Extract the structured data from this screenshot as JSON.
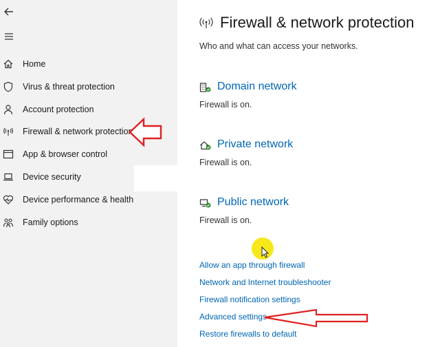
{
  "sidebar": {
    "back_icon": "back-arrow-icon",
    "menu_icon": "hamburger-menu-icon",
    "items": [
      {
        "label": "Home",
        "icon": "home-icon"
      },
      {
        "label": "Virus & threat protection",
        "icon": "shield-icon"
      },
      {
        "label": "Account protection",
        "icon": "person-icon"
      },
      {
        "label": "Firewall & network protection",
        "icon": "wireless-antenna-icon"
      },
      {
        "label": "App & browser control",
        "icon": "browser-window-icon"
      },
      {
        "label": "Device security",
        "icon": "laptop-icon"
      },
      {
        "label": "Device performance & health",
        "icon": "heart-pulse-icon"
      },
      {
        "label": "Family options",
        "icon": "family-icon"
      }
    ]
  },
  "main": {
    "title": "Firewall & network protection",
    "title_icon": "wireless-antenna-icon",
    "subtitle": "Who and what can access your networks.",
    "networks": [
      {
        "title": "Domain network",
        "status": "Firewall is on.",
        "icon": "domain-building-icon"
      },
      {
        "title": "Private network",
        "status": "Firewall is on.",
        "icon": "private-home-icon"
      },
      {
        "title": "Public network",
        "status": "Firewall is on.",
        "icon": "public-monitor-icon"
      }
    ],
    "links": [
      "Allow an app through firewall",
      "Network and Internet troubleshooter",
      "Firewall notification settings",
      "Advanced settings",
      "Restore firewalls to default"
    ]
  },
  "colors": {
    "link": "#0066b4",
    "sidebar_bg": "#f2f2f2",
    "annotation_arrow": "#e02020",
    "status_ok": "#2e8b2e",
    "cursor_highlight": "#f5e500"
  }
}
